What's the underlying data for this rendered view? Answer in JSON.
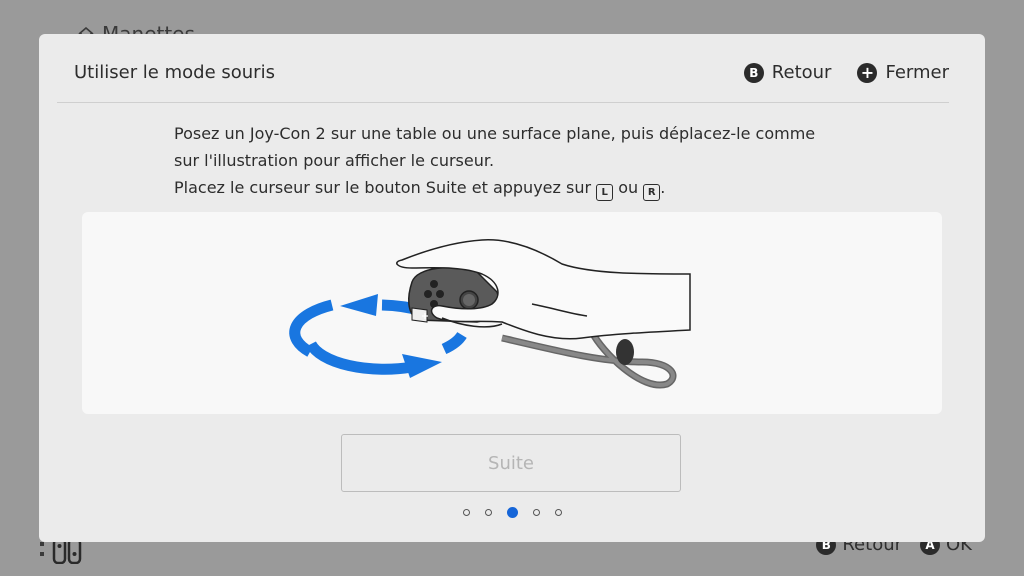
{
  "background": {
    "header_title": "Manettes",
    "footer_actions": [
      {
        "button": "B",
        "label": "Retour"
      },
      {
        "button": "A",
        "label": "OK"
      }
    ]
  },
  "modal": {
    "title": "Utiliser le mode souris",
    "actions": [
      {
        "button": "B",
        "label": "Retour",
        "icon": "b-button-icon"
      },
      {
        "button": "+",
        "label": "Fermer",
        "icon": "plus-button-icon"
      }
    ],
    "instructions": {
      "line1": "Posez un Joy-Con 2 sur une table ou une surface plane, puis déplacez-le comme",
      "line2": "sur l'illustration pour afficher le curseur.",
      "line3_before": "Placez le curseur sur le bouton Suite et appuyez sur ",
      "key_l": "L",
      "line3_mid": " ou ",
      "key_r": "R",
      "line3_after": "."
    },
    "next_button": "Suite",
    "pagination": {
      "total": 5,
      "current": 3
    }
  },
  "colors": {
    "accent": "#1565d8",
    "modal_bg": "#ebebeb",
    "illustration_bg": "#f8f8f8"
  }
}
